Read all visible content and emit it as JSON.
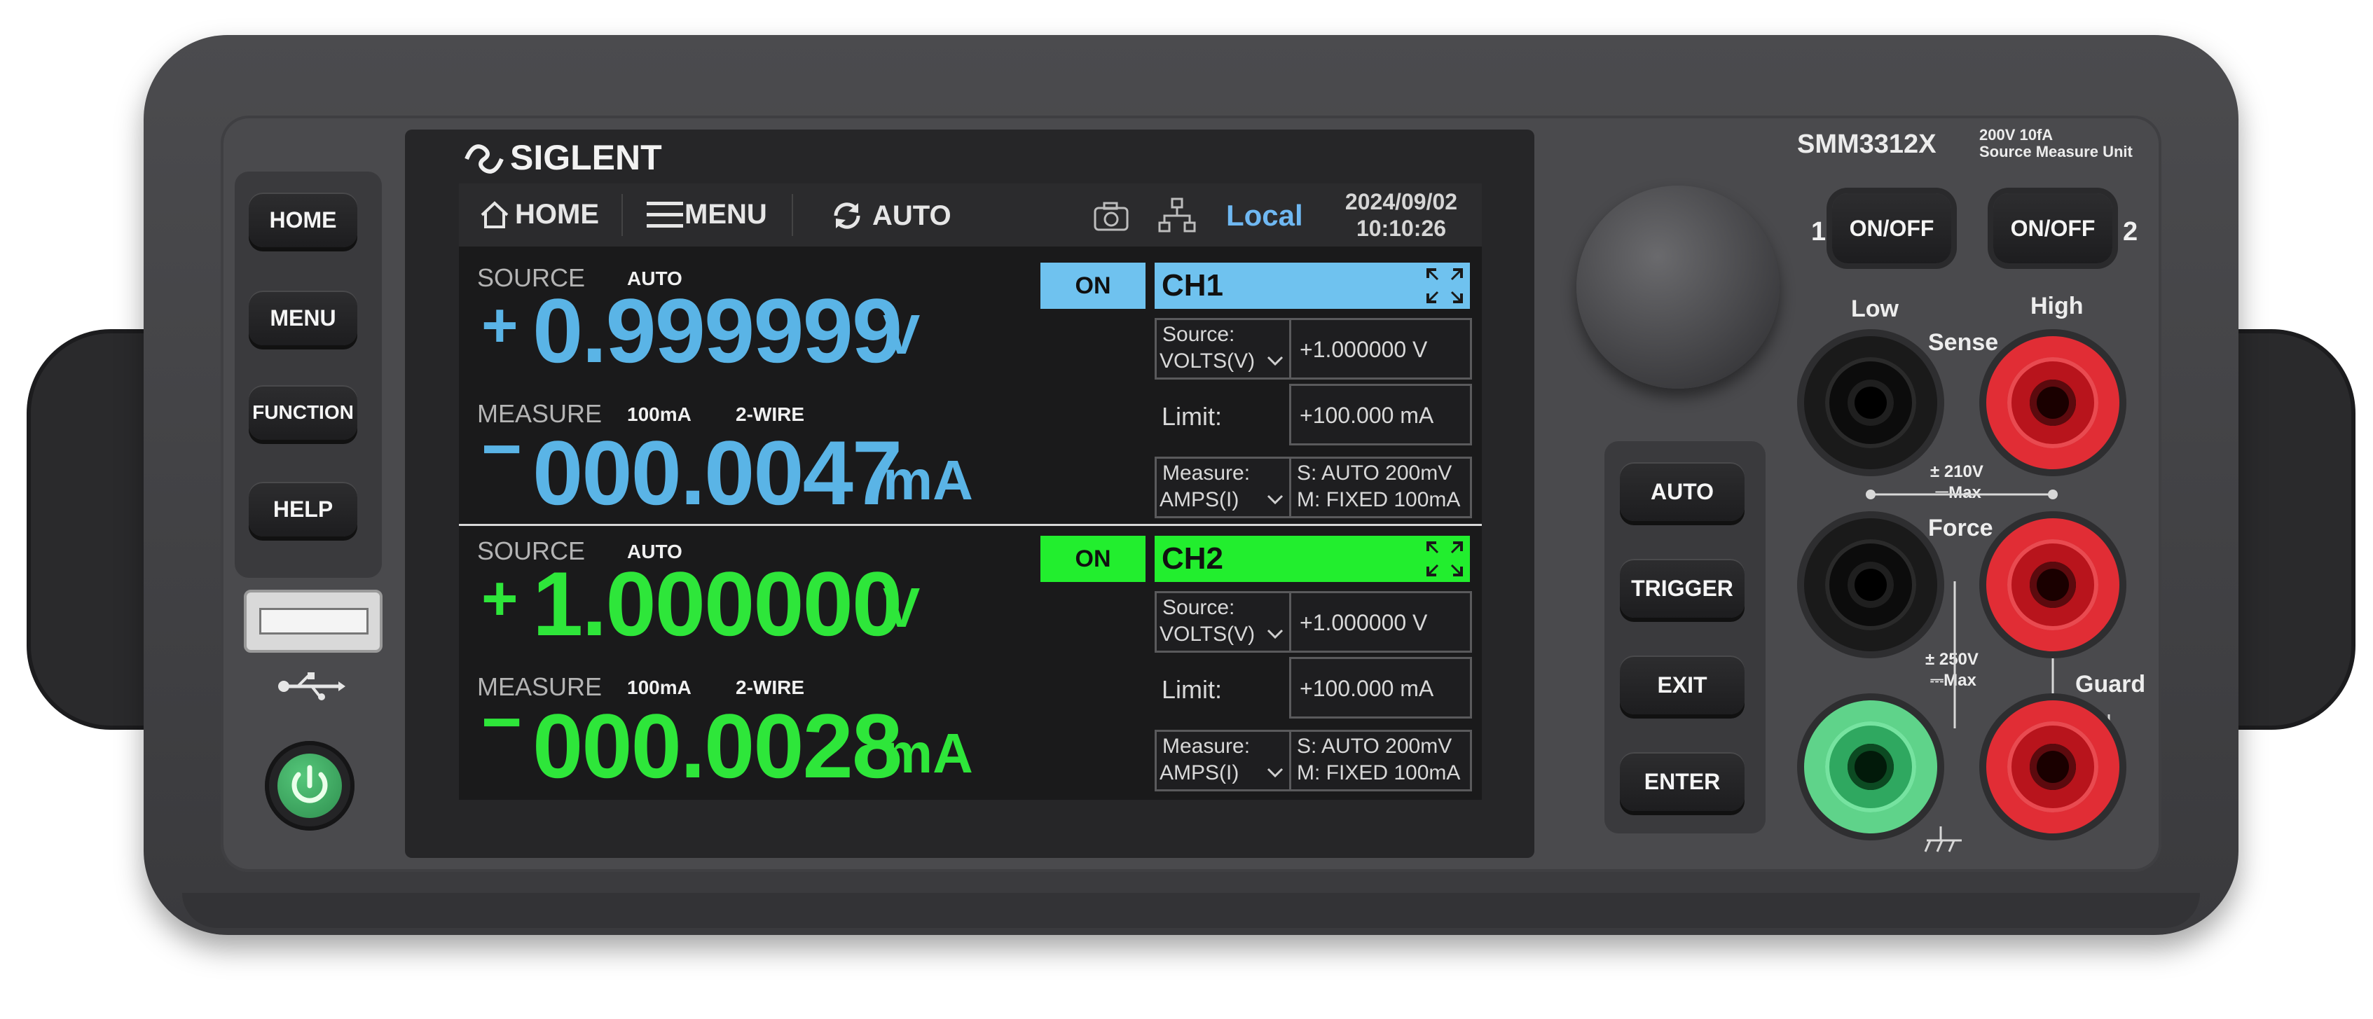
{
  "brand": "SIGLENT",
  "model": "SMM3312X",
  "model_rating": "200V   10fA",
  "model_desc": "Source Measure Unit",
  "left_buttons": [
    "HOME",
    "MENU",
    "FUNCTION",
    "HELP"
  ],
  "topbar": {
    "home": "HOME",
    "menu": "MENU",
    "auto": "AUTO",
    "mode": "Local",
    "date": "2024/09/02",
    "time": "10:10:26"
  },
  "channels": [
    {
      "name": "CH1",
      "state": "ON",
      "color": "#5ab4e6",
      "bar_color": "#6fc2ef",
      "source_label": "SOURCE",
      "source_mode": "AUTO",
      "source_sign": "+",
      "source_value": "0.999999",
      "source_unit": "V",
      "measure_label": "MEASURE",
      "measure_range": "100mA",
      "measure_wire": "2-WIRE",
      "measure_sign": "−",
      "measure_value": "000.0047",
      "measure_unit": "mA",
      "source_field_label": "Source:",
      "source_field_option": "VOLTS(V)",
      "source_setpoint": "+1.000000 V",
      "limit_label": "Limit:",
      "limit_value": "+100.000 mA",
      "measure_field_label": "Measure:",
      "measure_field_option": "AMPS(I)",
      "measure_s": "S:  AUTO 200mV",
      "measure_m": "M: FIXED 100mA"
    },
    {
      "name": "CH2",
      "state": "ON",
      "color": "#2ee63a",
      "bar_color": "#22ee2e",
      "source_label": "SOURCE",
      "source_mode": "AUTO",
      "source_sign": "+",
      "source_value": "1.000000",
      "source_unit": "V",
      "measure_label": "MEASURE",
      "measure_range": "100mA",
      "measure_wire": "2-WIRE",
      "measure_sign": "−",
      "measure_value": "000.0028",
      "measure_unit": "mA",
      "source_field_label": "Source:",
      "source_field_option": "VOLTS(V)",
      "source_setpoint": "+1.000000 V",
      "limit_label": "Limit:",
      "limit_value": "+100.000 mA",
      "measure_field_label": "Measure:",
      "measure_field_option": "AMPS(I)",
      "measure_s": "S:  AUTO 200mV",
      "measure_m": "M: FIXED 100mA"
    }
  ],
  "right_buttons": [
    "AUTO",
    "TRIGGER",
    "EXIT",
    "ENTER"
  ],
  "output_buttons": {
    "ch1_num": "1",
    "ch1_label": "ON/OFF",
    "ch2_num": "2",
    "ch2_label": "ON/OFF"
  },
  "terminals": {
    "low": "Low",
    "high": "High",
    "sense": "Sense",
    "force": "Force",
    "guard": "Guard",
    "max_210": "± 210V",
    "max_210_unit": "⎓Max",
    "max_250": "± 250V",
    "max_250_unit": "⎓Max"
  },
  "icons": [
    "home-icon",
    "menu-icon",
    "refresh-icon",
    "camera-icon",
    "network-icon",
    "expand-icon",
    "usb-icon",
    "power-icon",
    "chevron-down-icon"
  ]
}
